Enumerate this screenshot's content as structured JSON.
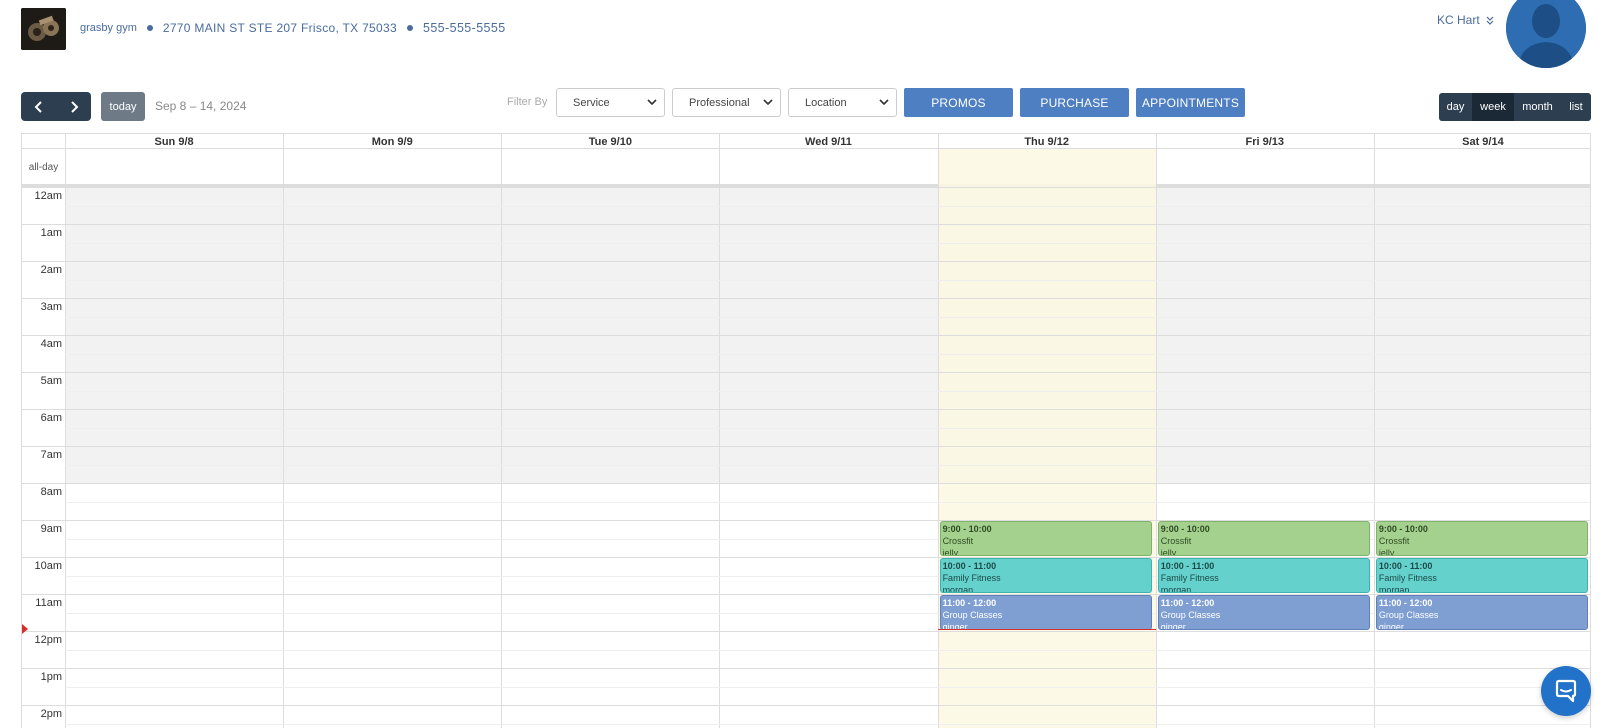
{
  "header": {
    "gym_name": "grasby gym",
    "address": "2770 MAIN ST STE 207 Frisco, TX 75033",
    "phone": "555-555-5555",
    "user_name": "KC Hart"
  },
  "toolbar": {
    "prev_icon": "chevron-left-icon",
    "next_icon": "chevron-right-icon",
    "today_label": "today",
    "date_range": "Sep 8 – 14, 2024",
    "filter_label": "Filter By",
    "filters": [
      {
        "value": "Service"
      },
      {
        "value": "Professional"
      },
      {
        "value": "Location"
      }
    ],
    "buttons": [
      "PROMOS",
      "PURCHASE",
      "APPOINTMENTS"
    ],
    "views": [
      "day",
      "week",
      "month",
      "list"
    ],
    "active_view": "week"
  },
  "calendar": {
    "allday_label": "all-day",
    "days": [
      "Sun 9/8",
      "Mon 9/9",
      "Tue 9/10",
      "Wed 9/11",
      "Thu 9/12",
      "Fri 9/13",
      "Sat 9/14"
    ],
    "today_index": 4,
    "hours": [
      "12am",
      "1am",
      "2am",
      "3am",
      "4am",
      "5am",
      "6am",
      "7am",
      "8am",
      "9am",
      "10am",
      "11am",
      "12pm",
      "1pm",
      "2pm"
    ],
    "business_hours_start": 8,
    "current_time_hour": 11.95,
    "events": [
      {
        "day": 4,
        "start": 9,
        "end": 10,
        "time": "9:00 - 10:00",
        "title": "Crossfit",
        "staff": "jelly",
        "color": "green"
      },
      {
        "day": 4,
        "start": 10,
        "end": 11,
        "time": "10:00 - 11:00",
        "title": "Family Fitness",
        "staff": "morgan",
        "color": "teal"
      },
      {
        "day": 4,
        "start": 11,
        "end": 12,
        "time": "11:00 - 12:00",
        "title": "Group Classes",
        "staff": "ginger",
        "color": "blue"
      },
      {
        "day": 5,
        "start": 9,
        "end": 10,
        "time": "9:00 - 10:00",
        "title": "Crossfit",
        "staff": "jelly",
        "color": "green"
      },
      {
        "day": 5,
        "start": 10,
        "end": 11,
        "time": "10:00 - 11:00",
        "title": "Family Fitness",
        "staff": "morgan",
        "color": "teal"
      },
      {
        "day": 5,
        "start": 11,
        "end": 12,
        "time": "11:00 - 12:00",
        "title": "Group Classes",
        "staff": "ginger",
        "color": "blue"
      },
      {
        "day": 6,
        "start": 9,
        "end": 10,
        "time": "9:00 - 10:00",
        "title": "Crossfit",
        "staff": "jelly",
        "color": "green"
      },
      {
        "day": 6,
        "start": 10,
        "end": 11,
        "time": "10:00 - 11:00",
        "title": "Family Fitness",
        "staff": "morgan",
        "color": "teal"
      },
      {
        "day": 6,
        "start": 11,
        "end": 12,
        "time": "11:00 - 12:00",
        "title": "Group Classes",
        "staff": "ginger",
        "color": "blue"
      }
    ]
  },
  "colors": {
    "accent": "#4f7fc3",
    "nav_dark": "#2c3e50",
    "today_highlight": "#fcf8e3",
    "now_indicator": "#d62d2d"
  },
  "chat_icon": "chat-bubble-icon"
}
